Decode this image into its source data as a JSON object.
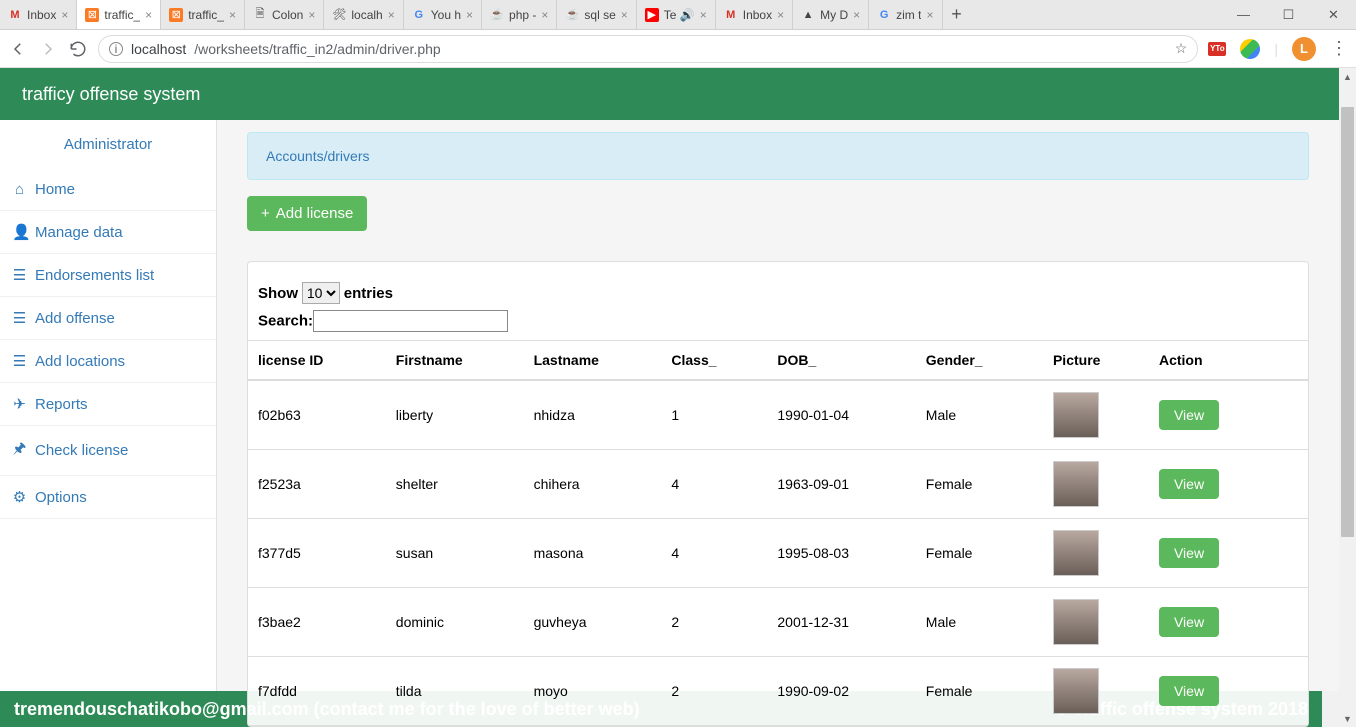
{
  "tabs": [
    {
      "label": "Inbox",
      "iconStyle": "color:#d93025;font-weight:bold",
      "iconText": "M"
    },
    {
      "label": "traffic_",
      "iconStyle": "background:#fb7a24;color:#fff;border-radius:2px;padding:0 2px",
      "iconText": "⊠"
    },
    {
      "label": "traffic_",
      "iconStyle": "background:#fb7a24;color:#fff;border-radius:2px;padding:0 2px",
      "iconText": "⊠"
    },
    {
      "label": "Colon",
      "iconStyle": "",
      "iconText": "🗎"
    },
    {
      "label": "localh",
      "iconStyle": "",
      "iconText": "🛠"
    },
    {
      "label": "You h",
      "iconStyle": "color:#4285f4;font-weight:bold",
      "iconText": "G"
    },
    {
      "label": "php -",
      "iconStyle": "color:#e76f00",
      "iconText": "☕"
    },
    {
      "label": "sql se",
      "iconStyle": "color:#e76f00",
      "iconText": "☕"
    },
    {
      "label": "Te 🔊",
      "iconStyle": "background:#f00;color:#fff;border-radius:2px;padding:0 2px",
      "iconText": "▶"
    },
    {
      "label": "Inbox",
      "iconStyle": "color:#d93025;font-weight:bold",
      "iconText": "M"
    },
    {
      "label": "My D",
      "iconStyle": "",
      "iconText": "▲"
    },
    {
      "label": "zim t",
      "iconStyle": "color:#4285f4;font-weight:bold",
      "iconText": "G"
    }
  ],
  "active_tab_index": 1,
  "win": {
    "min": "—",
    "max": "☐",
    "close": "✕"
  },
  "address": {
    "host": "localhost",
    "path": "/worksheets/traffic_in2/admin/driver.php",
    "star": "☆",
    "avatar": "L"
  },
  "header_title": "trafficy offense system",
  "sidebar": {
    "title": "Administrator",
    "items": [
      {
        "label": "Home",
        "icon": "⌂"
      },
      {
        "label": "Manage data",
        "icon": "👤"
      },
      {
        "label": "Endorsements list",
        "icon": "☰"
      },
      {
        "label": "Add offense",
        "icon": "☰"
      },
      {
        "label": "Add locations",
        "icon": "☰"
      },
      {
        "label": "Reports",
        "icon": "✈"
      },
      {
        "label": "Check license",
        "icon": "🖈"
      },
      {
        "label": "Options",
        "icon": "⚙"
      }
    ]
  },
  "breadcrumb": "Accounts/drivers",
  "add_license": {
    "icon": "+",
    "label": "Add license"
  },
  "dt": {
    "show_pre": "Show",
    "show_post": "entries",
    "length": "10",
    "search_label": "Search:",
    "search_value": "",
    "headers": [
      "license ID",
      "Firstname",
      "Lastname",
      "Class_",
      "DOB_",
      "Gender_",
      "Picture",
      "Action"
    ],
    "action_label": "View",
    "rows": [
      {
        "id": "f02b63",
        "fn": "liberty",
        "ln": "nhidza",
        "cls": "1",
        "dob": "1990-01-04",
        "gen": "Male"
      },
      {
        "id": "f2523a",
        "fn": "shelter",
        "ln": "chihera",
        "cls": "4",
        "dob": "1963-09-01",
        "gen": "Female"
      },
      {
        "id": "f377d5",
        "fn": "susan",
        "ln": "masona",
        "cls": "4",
        "dob": "1995-08-03",
        "gen": "Female"
      },
      {
        "id": "f3bae2",
        "fn": "dominic",
        "ln": "guvheya",
        "cls": "2",
        "dob": "2001-12-31",
        "gen": "Male"
      },
      {
        "id": "f7dfdd",
        "fn": "tilda",
        "ln": "moyo",
        "cls": "2",
        "dob": "1990-09-02",
        "gen": "Female"
      }
    ]
  },
  "footer": {
    "left": "tremendouschatikobo@gmail.com (contact me for the love of better web)",
    "right": "© Traffic offense system 2018"
  }
}
